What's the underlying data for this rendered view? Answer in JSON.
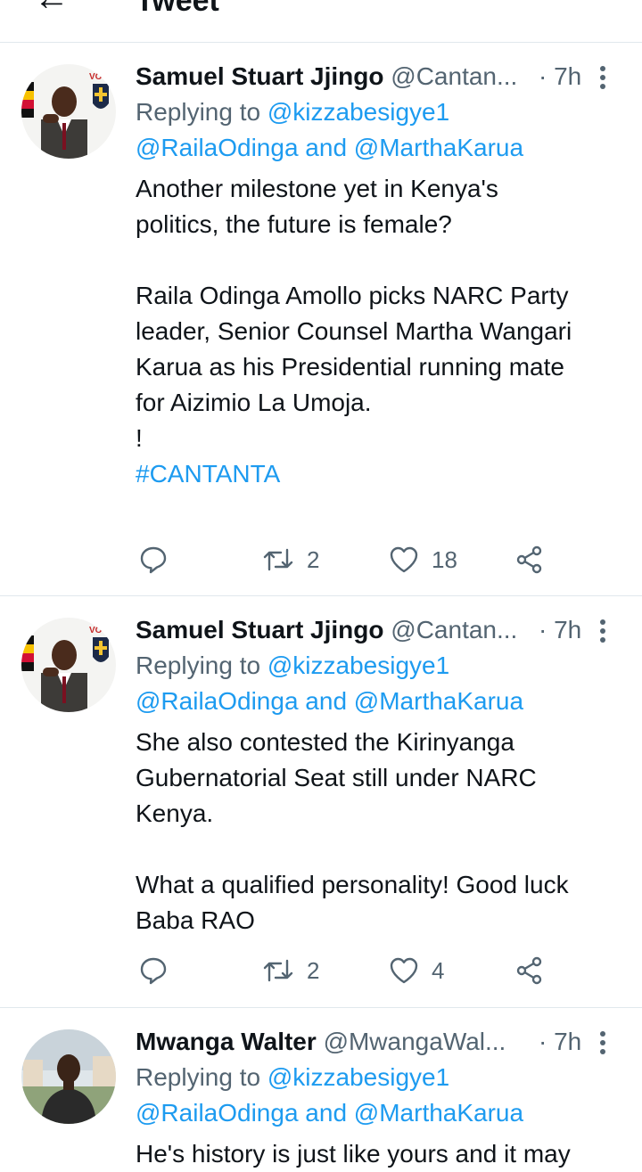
{
  "header": {
    "back_icon": "arrow-left-icon",
    "title": "Tweet"
  },
  "tweets": [
    {
      "name": "Samuel Stuart Jjingo",
      "handle": "@Cantan...",
      "time": "· 7h",
      "reply_prefix": "Replying to ",
      "reply_to_1": "@kizzabesigye1",
      "reply_to_2": "@RailaOdinga and @MarthaKarua",
      "body": "Another milestone yet in Kenya's\npolitics, the future is female?\n\nRaila Odinga Amollo picks NARC Party\nleader, Senior Counsel Martha Wangari\nKarua as his Presidential running mate\nfor Aizimio La Umoja.\n!\n",
      "hashtag": "#CANTANTA",
      "retweets": "2",
      "likes": "18",
      "avatar_badge": "VO"
    },
    {
      "name": "Samuel Stuart Jjingo",
      "handle": "@Cantan...",
      "time": "· 7h",
      "reply_prefix": "Replying to ",
      "reply_to_1": "@kizzabesigye1",
      "reply_to_2": "@RailaOdinga and @MarthaKarua",
      "body": "She also contested the Kirinyanga\nGubernatorial Seat still under NARC\nKenya.\n\nWhat a qualified personality! Good luck\nBaba RAO",
      "retweets": "2",
      "likes": "4",
      "avatar_badge": "VO"
    },
    {
      "name": "Mwanga Walter",
      "handle": "@MwangaWal...",
      "time": "· 7h",
      "reply_prefix": "Replying to ",
      "reply_to_1": "@kizzabesigye1",
      "reply_to_2": "@RailaOdinga and @MarthaKarua",
      "body": "He's history is just like yours and it may"
    }
  ],
  "icons": {
    "reply": "reply-icon",
    "retweet": "retweet-icon",
    "like": "heart-icon",
    "share": "share-icon",
    "more": "more-vertical-icon"
  },
  "colors": {
    "link": "#1d9bf0",
    "secondary": "#536471",
    "text": "#0f1419",
    "divider": "#e1e8ed"
  }
}
